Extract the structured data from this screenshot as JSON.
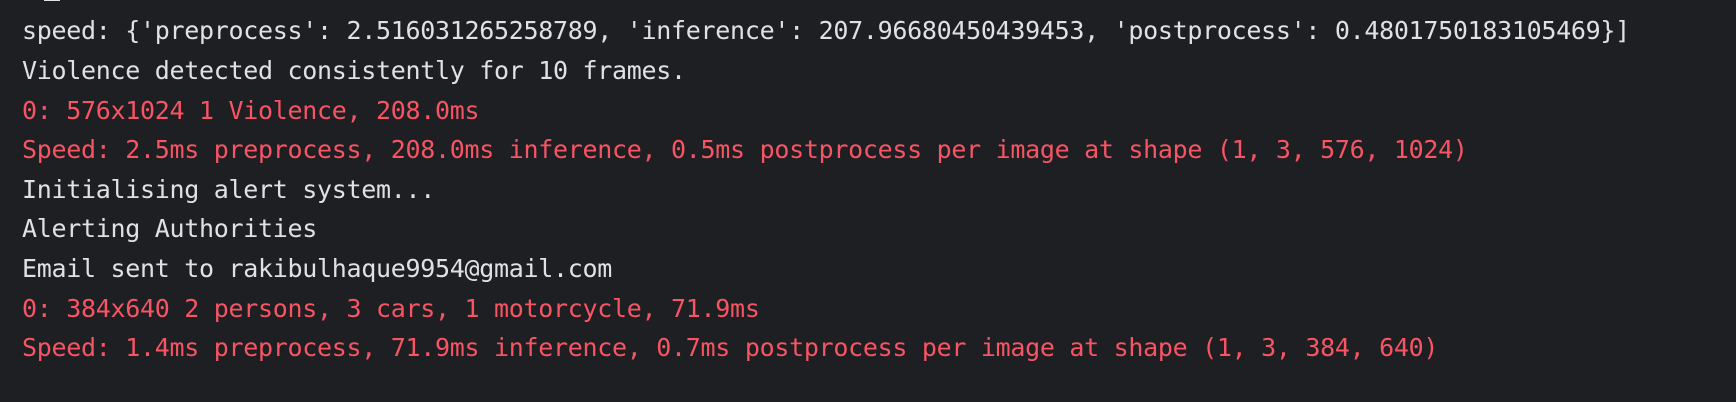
{
  "console": {
    "lines": [
      {
        "text": "speed: {'preprocess': 2.516031265258789, 'inference': 207.96680450439453, 'postprocess': 0.4801750183105469}]",
        "kind": "normal"
      },
      {
        "text": "Violence detected consistently for 10 frames.",
        "kind": "normal"
      },
      {
        "text": "0: 576x1024 1 Violence, 208.0ms",
        "kind": "error"
      },
      {
        "text": "Speed: 2.5ms preprocess, 208.0ms inference, 0.5ms postprocess per image at shape (1, 3, 576, 1024)",
        "kind": "error"
      },
      {
        "text": "Initialising alert system...",
        "kind": "normal"
      },
      {
        "text": "Alerting Authorities",
        "kind": "normal"
      },
      {
        "text": "Email sent to rakibulhaque9954@gmail.com",
        "kind": "normal"
      },
      {
        "text": "0: 384x640 2 persons, 3 cars, 1 motorcycle, 71.9ms",
        "kind": "error"
      },
      {
        "text": "Speed: 1.4ms preprocess, 71.9ms inference, 0.7ms postprocess per image at shape (1, 3, 384, 640)",
        "kind": "error"
      }
    ]
  },
  "colors": {
    "background": "#1e1f22",
    "stdout": "#dfe1e5",
    "stderr": "#f75464"
  }
}
